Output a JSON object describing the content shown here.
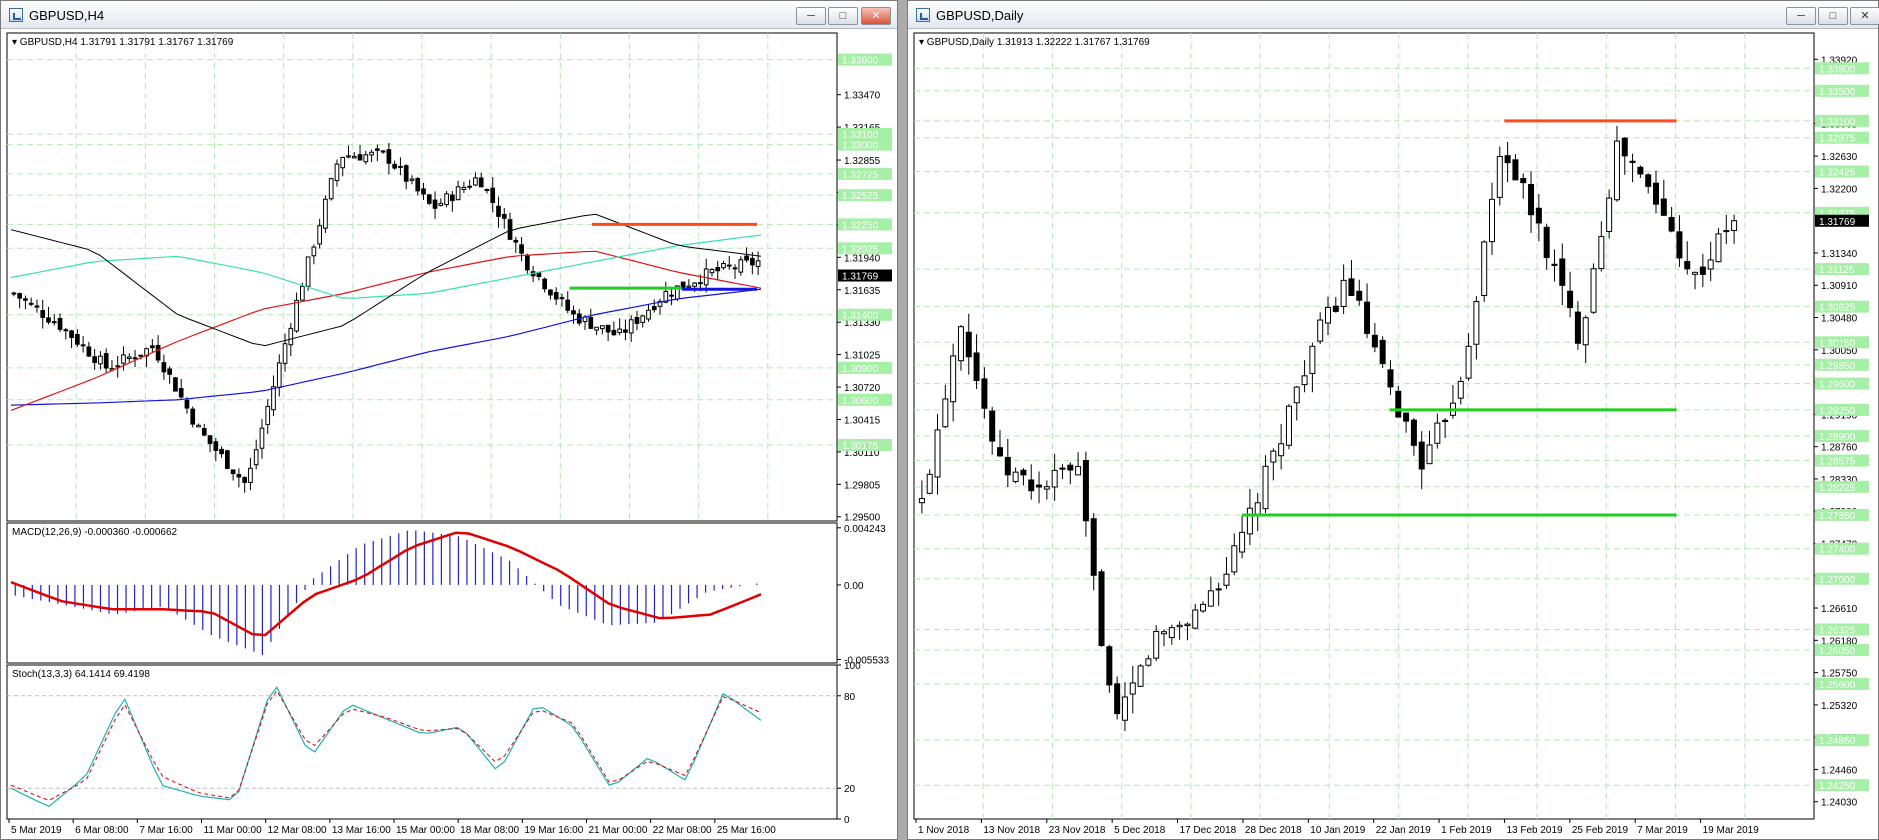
{
  "left_window": {
    "title": "GBPUSD,H4",
    "buttons": [
      "minimize",
      "maximize",
      "close"
    ]
  },
  "right_window": {
    "title": "GBPUSD,Daily",
    "buttons": [
      "minimize",
      "maximize",
      "close"
    ]
  },
  "colors": {
    "bull": "#ffffff",
    "bear": "#000000",
    "grid": "#b6e7b6",
    "resistance": "#ff4a1c",
    "support": "#1ecf1e",
    "ma_blue": "#1414e0",
    "ma_red": "#e01414",
    "ma_teal": "#38e0b0",
    "ma_black": "#000000",
    "macd_hist": "#2020d0",
    "macd_signal": "#e00000",
    "stoch_main": "#20b0b0",
    "stoch_signal": "#e00000",
    "price_label_bg": "#a6efa6",
    "current_label_bg": "#000000"
  },
  "chart_data": [
    {
      "name": "h4_main",
      "type": "candlestick",
      "title": "GBPUSD,H4  1.31791 1.31791 1.31767 1.31769",
      "ylim": [
        1.2946,
        1.3405
      ],
      "y_ticks": [
        "1.33470",
        "1.33165",
        "1.32855",
        "1.32550",
        "1.32245",
        "1.31940",
        "1.31635",
        "1.31330",
        "1.31025",
        "1.30720",
        "1.30415",
        "1.30110",
        "1.29805",
        "1.29500"
      ],
      "price_labels": [
        "1.33800",
        "1.33100",
        "1.33000",
        "1.32725",
        "1.32525",
        "1.32250",
        "1.32025",
        "1.31400",
        "1.30900",
        "1.30600",
        "1.30175"
      ],
      "current_price": "1.31769",
      "x_ticks": [
        "5 Mar 2019",
        "6 Mar 08:00",
        "7 Mar 16:00",
        "11 Mar 00:00",
        "12 Mar 08:00",
        "13 Mar 16:00",
        "15 Mar 00:00",
        "18 Mar 08:00",
        "19 Mar 16:00",
        "21 Mar 00:00",
        "22 Mar 08:00",
        "25 Mar 16:00"
      ],
      "close_anchors": [
        1.316,
        1.313,
        1.309,
        1.311,
        1.303,
        1.298,
        1.314,
        1.329,
        1.329,
        1.324,
        1.327,
        1.319,
        1.314,
        1.312,
        1.316,
        1.318,
        1.319
      ],
      "anchor_amp": 0.0012,
      "candle_count": 130,
      "resistance": {
        "value": 1.3225,
        "from_frac": 0.78,
        "to_frac": 1.0
      },
      "support": {
        "value": 1.3165,
        "from_frac": 0.75,
        "to_frac": 0.9
      },
      "support_blue": {
        "value": 1.3164,
        "from_frac": 0.9,
        "to_frac": 1.0
      },
      "ma_blue_anchors": [
        1.3055,
        1.3057,
        1.306,
        1.3068,
        1.3085,
        1.3105,
        1.312,
        1.314,
        1.3155,
        1.3164
      ],
      "ma_red_anchors": [
        1.305,
        1.308,
        1.3115,
        1.3145,
        1.316,
        1.318,
        1.3195,
        1.32,
        1.318,
        1.3165
      ],
      "ma_teal_anchors": [
        1.3175,
        1.319,
        1.3195,
        1.318,
        1.3155,
        1.316,
        1.3175,
        1.319,
        1.3205,
        1.3215
      ],
      "ma_black_anchors": [
        1.322,
        1.32,
        1.314,
        1.311,
        1.313,
        1.318,
        1.322,
        1.3235,
        1.3205,
        1.3195
      ]
    },
    {
      "name": "h4_macd",
      "type": "histogram+line",
      "title": "MACD(12,26,9) -0.000360 -0.000662",
      "ylim": [
        -0.0058,
        0.0046
      ],
      "y_ticks": [
        "0.004243",
        "0.00",
        "-0.005533"
      ],
      "hist_anchors": [
        -0.0008,
        -0.0015,
        -0.0022,
        -0.0016,
        -0.0038,
        -0.0052,
        0.0004,
        0.003,
        0.0041,
        0.0036,
        0.0018,
        -0.0015,
        -0.003,
        -0.0028,
        -0.0005,
        0.0001
      ],
      "signal_anchors": [
        0.0002,
        -0.0012,
        -0.0018,
        -0.0018,
        -0.002,
        -0.004,
        -0.0008,
        0.0005,
        0.0028,
        0.004,
        0.0028,
        0.001,
        -0.0015,
        -0.0025,
        -0.0022,
        -0.0007
      ]
    },
    {
      "name": "h4_stoch",
      "type": "line",
      "title": "Stoch(13,3,3) 64.1414 69.4198",
      "ylim": [
        0,
        100
      ],
      "y_ticks": [
        "100",
        "80",
        "20",
        "0"
      ],
      "main_anchors": [
        20,
        8,
        28,
        80,
        22,
        15,
        12,
        90,
        40,
        75,
        65,
        55,
        60,
        30,
        75,
        60,
        20,
        40,
        25,
        82,
        64
      ],
      "signal_anchors": [
        22,
        12,
        25,
        76,
        28,
        17,
        13,
        87,
        45,
        72,
        66,
        57,
        59,
        35,
        72,
        62,
        22,
        38,
        28,
        80,
        69
      ]
    },
    {
      "name": "daily_main",
      "type": "candlestick",
      "title": "GBPUSD,Daily  1.31913 1.32222 1.31767 1.31769",
      "ylim": [
        1.238,
        1.3427
      ],
      "y_ticks": [
        "1.33920",
        "1.33065",
        "1.32630",
        "1.32200",
        "1.31340",
        "1.30910",
        "1.30480",
        "1.30050",
        "1.29620",
        "1.29190",
        "1.28760",
        "1.28330",
        "1.27900",
        "1.27470",
        "1.27040",
        "1.26610",
        "1.26180",
        "1.25750",
        "1.25320",
        "1.24890",
        "1.24460",
        "1.24030"
      ],
      "price_labels": [
        "1.33800",
        "1.33500",
        "1.33100",
        "1.32875",
        "1.32425",
        "1.31875",
        "1.31125",
        "1.30625",
        "1.30150",
        "1.29850",
        "1.29600",
        "1.29250",
        "1.28900",
        "1.28575",
        "1.28225",
        "1.27850",
        "1.27400",
        "1.27000",
        "1.26325",
        "1.26050",
        "1.25600",
        "1.24850",
        "1.24250"
      ],
      "current_price": "1.31769",
      "x_ticks": [
        "1 Nov 2018",
        "13 Nov 2018",
        "23 Nov 2018",
        "5 Dec 2018",
        "17 Dec 2018",
        "28 Dec 2018",
        "10 Jan 2019",
        "22 Jan 2019",
        "1 Feb 2019",
        "13 Feb 2019",
        "25 Feb 2019",
        "7 Mar 2019",
        "19 Mar 2019"
      ],
      "close_anchors": [
        1.28,
        1.305,
        1.285,
        1.282,
        1.285,
        1.25,
        1.262,
        1.265,
        1.272,
        1.285,
        1.3,
        1.31,
        1.296,
        1.285,
        1.298,
        1.328,
        1.316,
        1.302,
        1.328,
        1.32,
        1.31,
        1.318
      ],
      "anchor_amp": 0.003,
      "candle_count": 105,
      "resistance": {
        "value": 1.331,
        "from_frac": 0.72,
        "to_frac": 0.93
      },
      "support_1": {
        "value": 1.2925,
        "from_frac": 0.58,
        "to_frac": 0.93
      },
      "support_2": {
        "value": 1.2785,
        "from_frac": 0.4,
        "to_frac": 0.93
      }
    }
  ]
}
